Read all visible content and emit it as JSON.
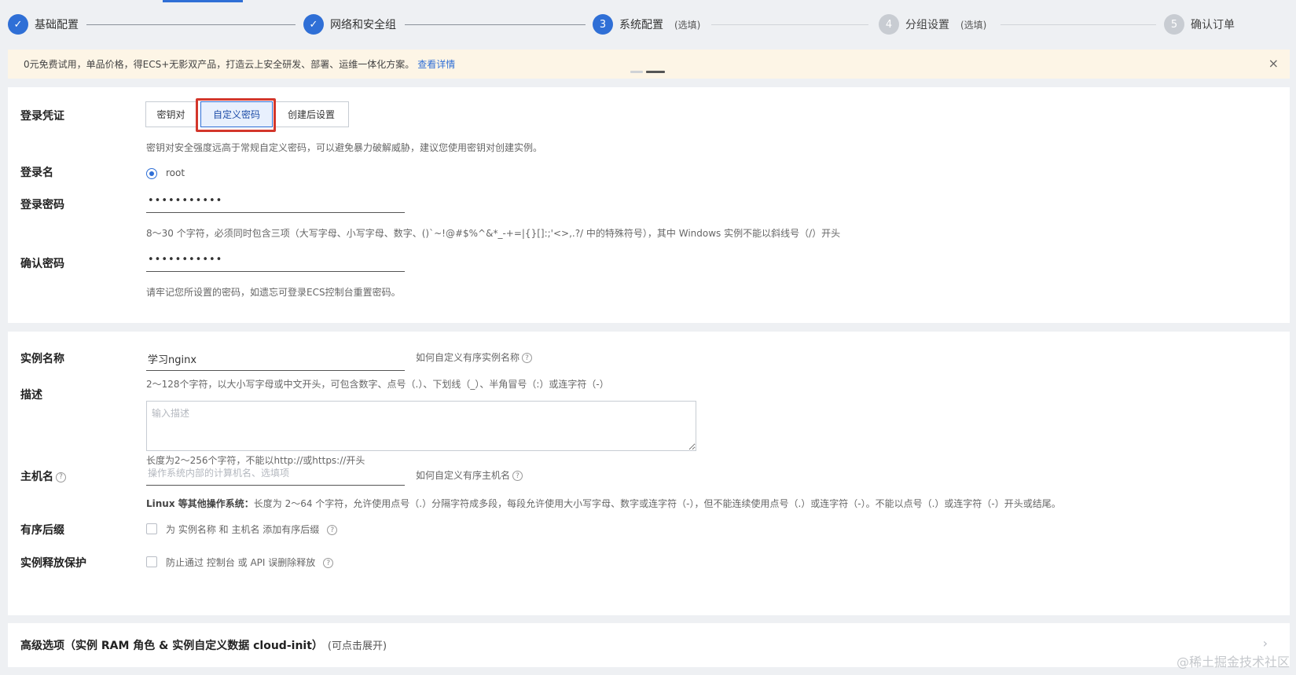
{
  "stepper": {
    "steps": [
      {
        "number": "✓",
        "label": "基础配置",
        "optional": ""
      },
      {
        "number": "✓",
        "label": "网络和安全组",
        "optional": ""
      },
      {
        "number": "3",
        "label": "系统配置",
        "optional": "(选填)"
      },
      {
        "number": "4",
        "label": "分组设置",
        "optional": "(选填)"
      },
      {
        "number": "5",
        "label": "确认订单",
        "optional": ""
      }
    ]
  },
  "notice": {
    "text": "0元免费试用，单品价格，得ECS+无影双产品，打造云上安全研发、部署、运维一体化方案。",
    "link": "查看详情",
    "close": "×"
  },
  "login": {
    "credential_label": "登录凭证",
    "credential_options": [
      "密钥对",
      "自定义密码",
      "创建后设置"
    ],
    "credential_selected": "自定义密码",
    "credential_hint": "密钥对安全强度远高于常规自定义密码，可以避免暴力破解威胁，建议您使用密钥对创建实例。",
    "username_label": "登录名",
    "username_value": "root",
    "password_label": "登录密码",
    "password_value": "•••••••••••",
    "password_hint": "8～30 个字符，必须同时包含三项（大写字母、小写字母、数字、()`~!@#$%^&*_-+=|{}[]:;'<>,.?/ 中的特殊符号），其中 Windows 实例不能以斜线号（/）开头",
    "confirm_label": "确认密码",
    "confirm_value": "•••••••••••",
    "confirm_hint": "请牢记您所设置的密码，如遗忘可登录ECS控制台重置密码。"
  },
  "instance": {
    "name_label": "实例名称",
    "name_value": "学习nginx",
    "name_help": "如何自定义有序实例名称",
    "name_hint": "2～128个字符，以大小写字母或中文开头，可包含数字、点号（.）、下划线（_）、半角冒号（:）或连字符（-）",
    "desc_label": "描述",
    "desc_placeholder": "输入描述",
    "desc_hint": "长度为2～256个字符，不能以http://或https://开头",
    "hostname_label": "主机名",
    "hostname_placeholder": "操作系统内部的计算机名、选填项",
    "hostname_help": "如何自定义有序主机名",
    "hostname_hint_bold": "Linux 等其他操作系统：",
    "hostname_hint": "长度为 2～64 个字符，允许使用点号（.）分隔字符成多段，每段允许使用大小写字母、数字或连字符（-），但不能连续使用点号（.）或连字符（-）。不能以点号（.）或连字符（-）开头或结尾。",
    "suffix_label": "有序后缀",
    "suffix_text": "为 实例名称 和 主机名 添加有序后缀",
    "release_label": "实例释放保护",
    "release_text": "防止通过 控制台 或 API 误删除释放"
  },
  "advanced": {
    "title": "高级选项（实例 RAM 角色 & 实例自定义数据 cloud-init）",
    "subtitle": "(可点击展开)"
  },
  "watermark": "@稀土掘金技术社区",
  "colors": {
    "primary": "#2f6fd6",
    "highlight": "#d3362b",
    "notice_bg": "#fdf5e6"
  }
}
